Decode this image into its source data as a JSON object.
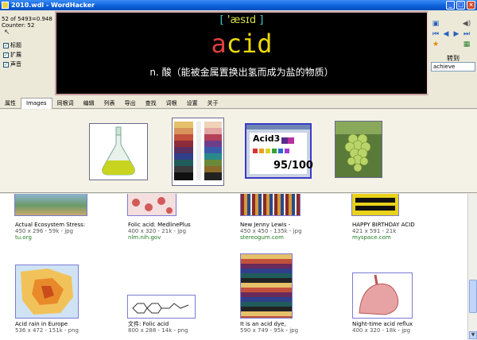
{
  "window": {
    "title": "2010.wdl - WordHacker"
  },
  "info": {
    "line1": "52 of 5493=0.948",
    "line2": "Counter: 52"
  },
  "checkboxes": [
    {
      "label": "标题",
      "checked": true
    },
    {
      "label": "扩展",
      "checked": true
    },
    {
      "label": "声音",
      "checked": true
    }
  ],
  "display": {
    "phonetic": "'æsɪd",
    "word_first": "a",
    "word_rest": "cid",
    "definition": "n. 酸（能被金属置换出氢而成为盐的物质）"
  },
  "right": {
    "label": "转到",
    "input": "achieve"
  },
  "tabs": [
    "属性",
    "Images",
    "同根词",
    "编辑",
    "列表",
    "导出",
    "查找",
    "词根",
    "设置",
    "关于"
  ],
  "active_tab": "Images",
  "strip_images": [
    "flask-image",
    "color-chart-image",
    "acid3-test-image",
    "grapes-image"
  ],
  "acid3": {
    "title": "Acid3",
    "score": "95/100"
  },
  "results": [
    {
      "title": "Actual Ecosystem Stress:",
      "meta": "450 x 296 - 59k - jpg",
      "url": "tu.org"
    },
    {
      "title": "Folic acid: MedlinePlus",
      "meta": "400 x 320 - 21k - jpg",
      "url": "nlm.nih.gov"
    },
    {
      "title": "New Jenny Lewis -",
      "meta": "450 x 450 - 135k - jpg",
      "url": "stereogum.com"
    },
    {
      "title": "HAPPY BIRTHDAY ACID",
      "meta": "421 x 591 - 21k",
      "url": "myspace.com"
    },
    {
      "title": "Acid rain in Europe",
      "meta": "536 x 472 - 151k - png",
      "url": ""
    },
    {
      "title": "文件: Folic acid",
      "meta": "800 x 288 - 14k - png",
      "url": ""
    },
    {
      "title": "It is an acid dye,",
      "meta": "590 x 749 - 95k - jpg",
      "url": ""
    },
    {
      "title": "Night-time acid reflux",
      "meta": "400 x 320 - 18k - jpg",
      "url": ""
    }
  ],
  "colors": {
    "titlebar": "#0a5fd8",
    "display_bg": "#000000",
    "word": "#ecd70b",
    "url": "#1f7a1f"
  }
}
